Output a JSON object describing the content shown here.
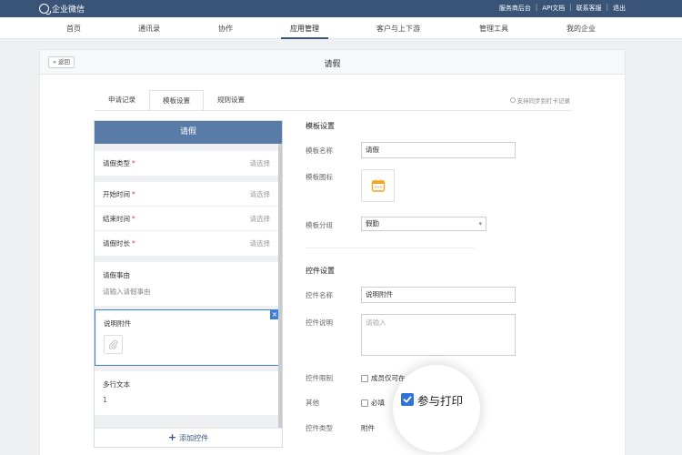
{
  "header": {
    "logo_text": "企业微信",
    "links": [
      "服务商后台",
      "API文档",
      "联系客服",
      "退出"
    ]
  },
  "nav": {
    "items": [
      "首页",
      "通讯录",
      "协作",
      "应用管理",
      "客户与上下游",
      "管理工具",
      "我的企业"
    ],
    "active": "应用管理"
  },
  "page": {
    "back_label": "« 返回",
    "title": "请假",
    "tabs": [
      "申请记录",
      "模板设置",
      "规则设置"
    ],
    "active_tab": "模板设置",
    "sync_label": "支持同步到打卡记录"
  },
  "preview": {
    "title": "请假",
    "fields": [
      {
        "label": "请假类型",
        "required": "*",
        "placeholder": "请选择"
      },
      {
        "label": "开始时间",
        "required": "*",
        "placeholder": "请选择"
      },
      {
        "label": "结束时间",
        "required": "*",
        "placeholder": "请选择"
      },
      {
        "label": "请假时长",
        "required": "*",
        "placeholder": "请选择"
      }
    ],
    "reason_label": "请假事由",
    "reason_placeholder": "请输入请假事由",
    "attachment_label": "说明附件",
    "close_glyph": "×",
    "multiline_label": "多行文本",
    "multiline_value": "1",
    "add_label": "添加控件",
    "add_glyph": "+"
  },
  "template_settings": {
    "section_title": "模板设置",
    "name_label": "模板名称",
    "name_value": "请假",
    "icon_label": "模板图标",
    "icon": "calendar-icon",
    "group_label": "模板分组",
    "group_value": "假勤",
    "caret": "▾"
  },
  "control_settings": {
    "section_title": "控件设置",
    "name_label": "控件名称",
    "name_value": "说明附件",
    "desc_label": "控件说明",
    "desc_placeholder": "请输入",
    "limit_label": "控件限制",
    "limit_option": "成员仅可在",
    "other_label": "其他",
    "required_option": "必填",
    "type_label": "控件类型",
    "type_value": "附件"
  },
  "magnifier": {
    "checkbox_label": "参与打印",
    "checked": true
  },
  "colors": {
    "header_bg": "#3a5478",
    "preview_header": "#587ba8",
    "selected_border": "#3d7fd6",
    "checkbox_blue": "#2f72d8",
    "icon_orange": "#f4a623"
  }
}
